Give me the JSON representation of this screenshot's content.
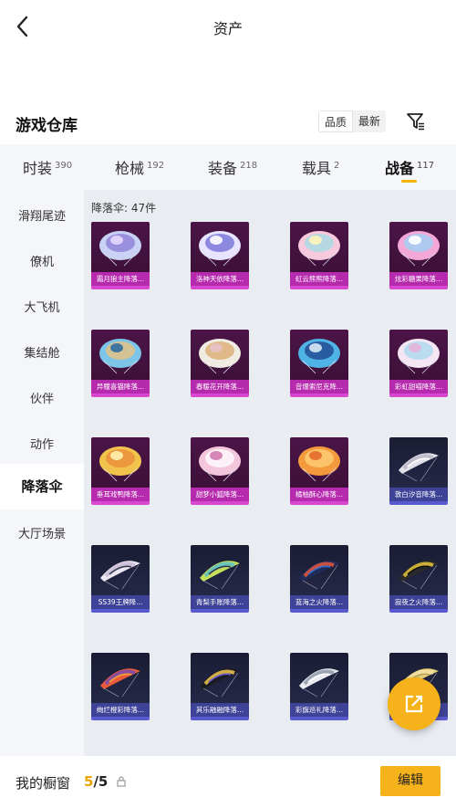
{
  "header": {
    "title": "资产",
    "back_icon": "chevron-left-icon"
  },
  "warehouse": {
    "title": "游戏仓库",
    "sort_options": [
      "品质",
      "最新"
    ],
    "sort_selected": "品质",
    "filter_icon": "filter-icon"
  },
  "tabs": [
    {
      "label": "时装",
      "count": "390"
    },
    {
      "label": "枪械",
      "count": "192"
    },
    {
      "label": "装备",
      "count": "218"
    },
    {
      "label": "载具",
      "count": "2"
    },
    {
      "label": "战备",
      "count": "117",
      "active": true
    }
  ],
  "sidebar": {
    "items": [
      "滑翔尾迹",
      "僚机",
      "大飞机",
      "集结舱",
      "伙伴",
      "动作",
      "降落伞",
      "大厅场景"
    ],
    "active": "降落伞"
  },
  "content": {
    "count_label": "降落伞: 47件",
    "items": [
      {
        "name": "霜月狼主降落...",
        "rarity": "purple"
      },
      {
        "name": "洛神天依降落...",
        "rarity": "purple"
      },
      {
        "name": "虹云熊熊降落...",
        "rarity": "purple"
      },
      {
        "name": "炫彩糖果降落...",
        "rarity": "purple"
      },
      {
        "name": "异瞳喜猫降落...",
        "rarity": "purple"
      },
      {
        "name": "春暖花开降落...",
        "rarity": "purple"
      },
      {
        "name": "音爆索尼克降...",
        "rarity": "purple"
      },
      {
        "name": "彩虹甜喵降落...",
        "rarity": "purple"
      },
      {
        "name": "垂耳戏鸭降落...",
        "rarity": "purple"
      },
      {
        "name": "甜梦小狐降落...",
        "rarity": "purple"
      },
      {
        "name": "橘柚酥心降落...",
        "rarity": "purple"
      },
      {
        "name": "敦白汐音降落...",
        "rarity": "blue"
      },
      {
        "name": "SS39王牌降...",
        "rarity": "blue"
      },
      {
        "name": "青梨手账降落...",
        "rarity": "blue"
      },
      {
        "name": "蓝海之火降落...",
        "rarity": "blue"
      },
      {
        "name": "寂夜之火降落...",
        "rarity": "blue"
      },
      {
        "name": "绚烂橙彩降落...",
        "rarity": "blue"
      },
      {
        "name": "其乐融融降落...",
        "rarity": "blue"
      },
      {
        "name": "彩旗巡礼降落...",
        "rarity": "blue"
      },
      {
        "name": "",
        "rarity": "blue"
      }
    ]
  },
  "fab": {
    "icon": "share-icon"
  },
  "showcase": {
    "label": "我的橱窗",
    "current": "5",
    "total": "/5",
    "edit_label": "编辑"
  },
  "colors": {
    "accent": "#f6b21a",
    "purple_rarity": "#b62aae",
    "blue_rarity": "#3e4397"
  }
}
